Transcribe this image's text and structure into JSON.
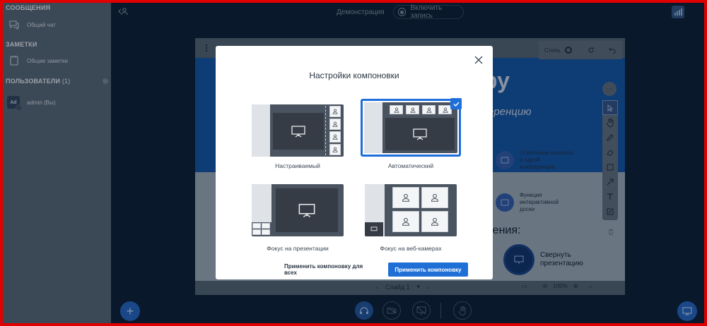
{
  "sidebar": {
    "messages_heading": "СООБЩЕНИЯ",
    "public_chat_label": "Общий чат",
    "notes_heading": "ЗАМЕТКИ",
    "shared_notes_label": "Общие заметки",
    "users_heading": "ПОЛЬЗОВАТЕЛИ",
    "users_count": "(1)",
    "user": {
      "initials": "Ad",
      "name": "admin (Вы)"
    }
  },
  "topbar": {
    "title": "Демонстрация",
    "record_label": "Включить запись"
  },
  "presentation": {
    "slide_title": "ру",
    "slide_subtitle": "еренцию",
    "features": [
      {
        "text": "Отдельные комнаты в одной конференции"
      },
      {
        "text": "Функция интерактивной доски"
      }
    ],
    "slide_heading": "пения:",
    "minimize_label": "Свернуть презентацию",
    "style_label": "Стиль",
    "slide_nav_label": "Слайд 1",
    "zoom_value": "100%"
  },
  "modal": {
    "title": "Настройки компоновки",
    "options": [
      {
        "id": "custom",
        "label": "Настраиваемый",
        "selected": false
      },
      {
        "id": "auto",
        "label": "Автоматический",
        "selected": true
      },
      {
        "id": "presentation-focus",
        "label": "Фокус на презентации",
        "selected": false
      },
      {
        "id": "webcam-focus",
        "label": "Фокус на веб-камерах",
        "selected": false
      }
    ],
    "apply_all_label": "Применить компоновку для всех",
    "apply_label": "Применить компоновку"
  },
  "colors": {
    "accent": "#1f6fd6",
    "sidebar_bg": "#52606c",
    "frame_border": "#e00000"
  }
}
